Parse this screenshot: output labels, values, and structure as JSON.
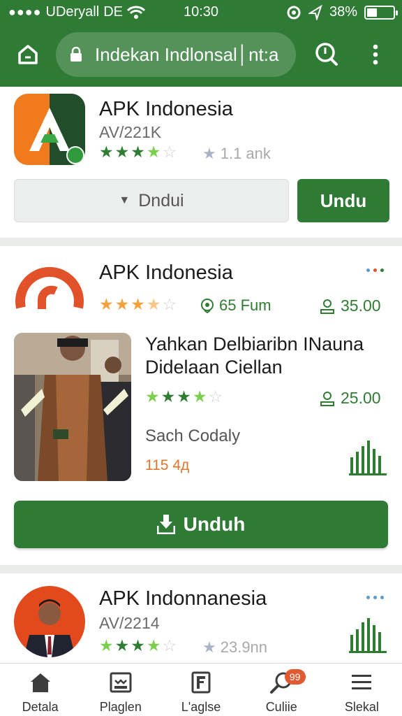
{
  "status_bar": {
    "carrier": "UDeryall",
    "network": "DE",
    "time": "10:30",
    "battery": "38%",
    "battery_level": 0.38
  },
  "app_bar": {
    "url": "Indekan Indlonsal│nt:a"
  },
  "card1": {
    "title": "APK Indonesia",
    "subtitle": "AV/221K",
    "rating": 3.5,
    "meta": "1.1 ank",
    "secondary_button": "Dndui",
    "primary_button": "Undu"
  },
  "card2": {
    "title": "APK Indonesia",
    "rating": 3.5,
    "meta_fum": "65 Fum",
    "price_top": "35.00",
    "feature_title": "Yahkan Delbiaribn INauna Didelaan Ciellan",
    "feature_rating": 4,
    "price_feature": "25.00",
    "caption": "Sach Codaly",
    "count": "115 4д",
    "download_button": "Unduh"
  },
  "card3": {
    "title": "APK Indonnanesia",
    "subtitle": "AV/2214",
    "rating": 4,
    "meta": "23.9nn"
  },
  "bottom_nav": {
    "items": [
      {
        "label": "Detala",
        "icon": "home-icon"
      },
      {
        "label": "Plaglen",
        "icon": "media-icon"
      },
      {
        "label": "L'aglse",
        "icon": "document-icon"
      },
      {
        "label": "Culiie",
        "icon": "search-icon",
        "badge": "99"
      },
      {
        "label": "Slekal",
        "icon": "list-icon"
      }
    ]
  },
  "colors": {
    "primary": "#2f7a35",
    "accent_orange": "#e25a32",
    "star_orange": "#f2a23c"
  }
}
